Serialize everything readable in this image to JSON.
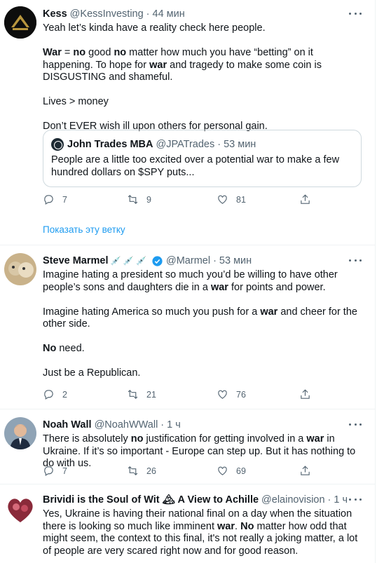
{
  "tweets": [
    {
      "name": "Kess",
      "handle": "@KessInvesting",
      "time": "44 мин",
      "replies": "7",
      "retweets": "9",
      "likes": "81",
      "quote": {
        "name": "John Trades MBA",
        "handle": "@JPATrades",
        "time": "53 мин",
        "text": "People are a little too excited over a potential war to make a few hundred dollars on $SPY puts..."
      }
    },
    {
      "name": "Steve Marmel",
      "emojis": "💉 💉 💉",
      "handle": "@Marmel",
      "time": "53 мин",
      "replies": "2",
      "retweets": "21",
      "likes": "76"
    },
    {
      "name": "Noah Wall",
      "handle": "@NoahWWall",
      "time": "1 ч",
      "replies": "7",
      "retweets": "26",
      "likes": "69"
    },
    {
      "name": "Brividi is the Soul of Wit 🏔 A View to Achille",
      "handle": "@elainovision",
      "time": "1 ч"
    }
  ],
  "show_thread": "Показать эту ветку",
  "text": {
    "t0_p1": "Yeah let’s kinda have a reality check here people.",
    "t0_w1": "War",
    "t0_eq": " = ",
    "t0_w2": "no",
    "t0_a": " good ",
    "t0_w3": "no",
    "t0_b": " matter how much you have “betting” on it happening. To hope for ",
    "t0_w4": "war",
    "t0_c": " and tragedy to make some coin is DISGUSTING and shameful.",
    "t0_p3": "Lives > money",
    "t0_p4": "Don’t EVER wish ill upon others for personal gain.",
    "t1_a": "Imagine hating a president so much you’d be willing to have other people’s sons and daughters die in a ",
    "t1_w1": "war",
    "t1_b": " for points and power.",
    "t1_c": "Imagine hating America so much you push for a ",
    "t1_w2": "war",
    "t1_d": " and cheer for the other side.",
    "t1_w3": "No",
    "t1_e": " need.",
    "t1_f": "Just be a Republican.",
    "t2_a": "There is absolutely ",
    "t2_w1": "no",
    "t2_b": " justification for getting involved in a ",
    "t2_w2": "war",
    "t2_c": " in Ukraine. If it’s so important - Europe can step up. But it has nothing to do with us.",
    "t3_a": "Yes, Ukraine is having their national final on a day when the situation there is looking so much like imminent ",
    "t3_w1": "war",
    "t3_b": ". ",
    "t3_w2": "No",
    "t3_c": " matter how odd that might seem, the context to this final, it's not really a joking matter, a lot of people are very scared right now and for good reason."
  }
}
